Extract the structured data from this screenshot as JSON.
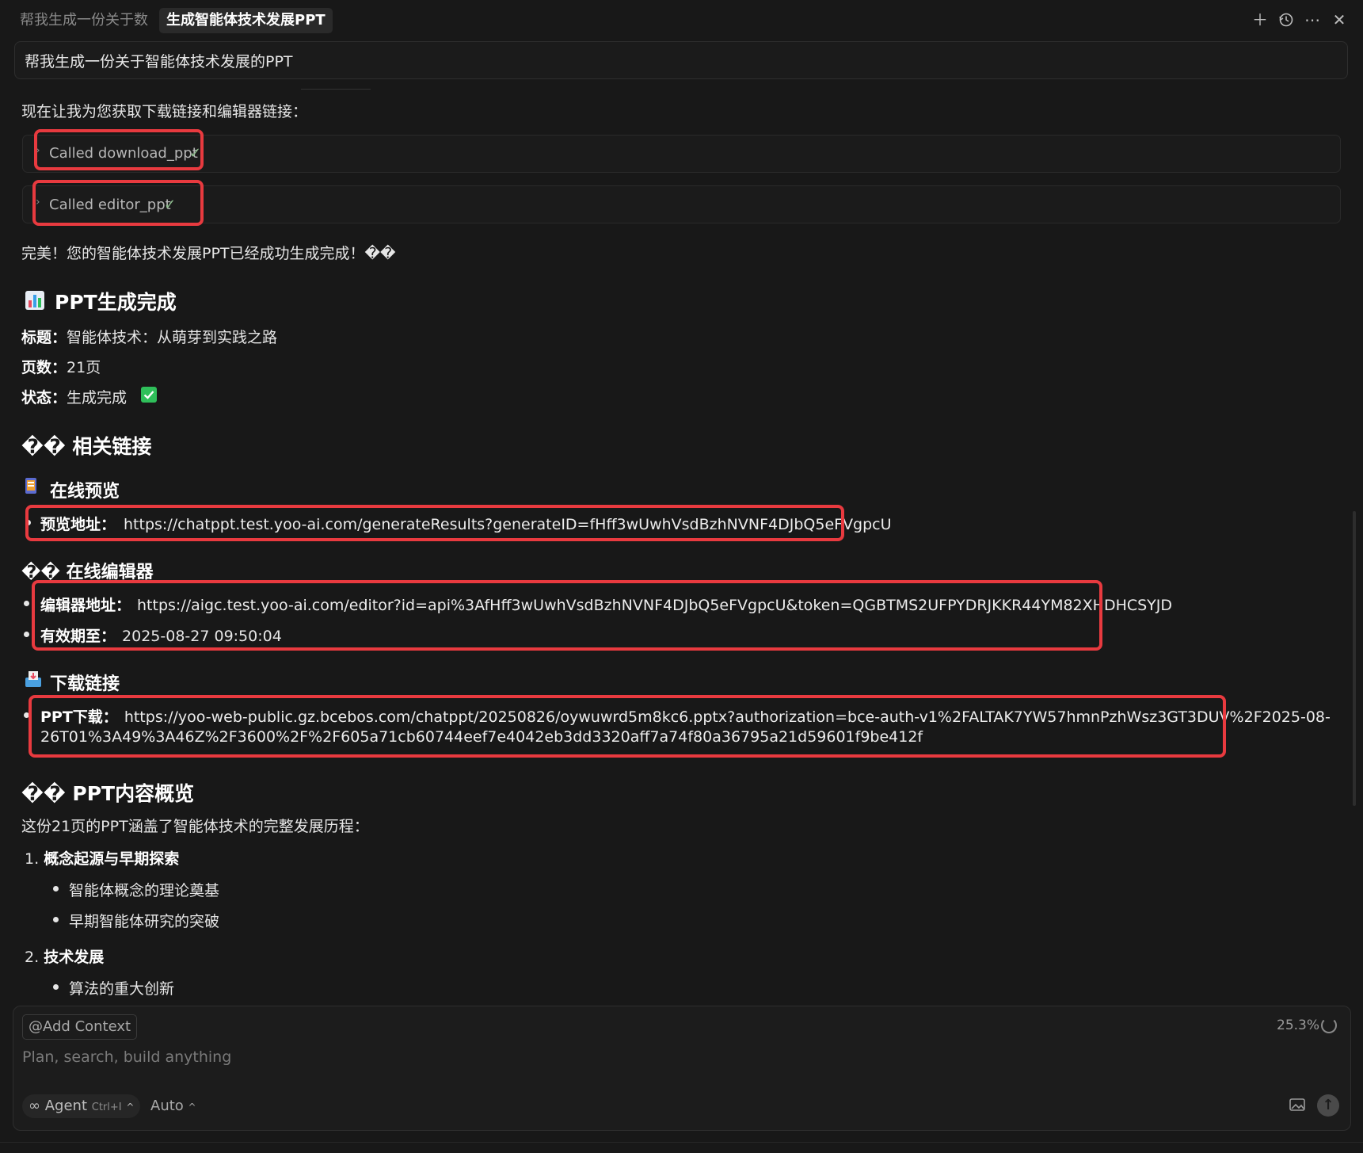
{
  "tabs": [
    {
      "label": "帮我生成一份关于数"
    },
    {
      "label": "生成智能体技术发展PPT"
    }
  ],
  "top_icons": [
    "plus-icon",
    "history-icon",
    "more-icon",
    "close-icon"
  ],
  "prompt": "帮我生成一份关于智能体技术发展的PPT",
  "intro": "现在让我为您获取下载链接和编辑器链接：",
  "tool_calls": [
    {
      "label": "Called download_ppt",
      "status": "✓"
    },
    {
      "label": "Called editor_ppt",
      "status": "✓"
    }
  ],
  "done_message": "完美！您的智能体技术发展PPT已经成功生成完成！��",
  "section_generated": {
    "heading": "PPT生成完成",
    "title_label": "标题：",
    "title_value": "智能体技术：从萌芽到实践之路",
    "pages_label": "页数：",
    "pages_value": "21页",
    "status_label": "状态：",
    "status_value": "生成完成"
  },
  "section_links": {
    "heading": "�� 相关链接",
    "preview": {
      "heading": "在线预览",
      "label": "预览地址：",
      "url": "https://chatppt.test.yoo-ai.com/generateResults?generateID=fHff3wUwhVsdBzhNVNF4DJbQ5eFVgpcU"
    },
    "editor": {
      "heading": "�� 在线编辑器",
      "label": "编辑器地址：",
      "url": "https://aigc.test.yoo-ai.com/editor?id=api%3AfHff3wUwhVsdBzhNVNF4DJbQ5eFVgpcU&token=QGBTMS2UFPYDRJKKR44YM82XHDHCSYJD",
      "expiry_label": "有效期至：",
      "expiry_value": "2025-08-27 09:50:04"
    },
    "download": {
      "heading": "下载链接",
      "label": "PPT下载：",
      "url_line1": "https://yoo-web-public.gz.bcebos.com/chatppt/20250826/oywuwrd5m8kc6.pptx?authorization=bce-auth-v1%2FALTAK7YW57hmnPzhWsz3GT3DUV%2F2025-08-",
      "url_line2": "26T01%3A49%3A46Z%2F3600%2F%2F605a71cb60744eef7e4042eb3dd3320aff7a74f80a36795a21d59601f9be412f"
    }
  },
  "section_overview": {
    "heading": "�� PPT内容概览",
    "intro": "这份21页的PPT涵盖了智能体技术的完整发展历程：",
    "items": [
      {
        "num": "1.",
        "title": "概念起源与早期探索",
        "bullets": [
          "智能体概念的理论奠基",
          "早期智能体研究的突破"
        ]
      },
      {
        "num": "2.",
        "title": "技术发展",
        "bullets": [
          "算法的重大创新"
        ]
      }
    ]
  },
  "input": {
    "add_context": "Add Context",
    "placeholder": "Plan, search, build anything",
    "usage": "25.3%",
    "agent_label": "Agent",
    "agent_shortcut": "Ctrl+I",
    "model_label": "Auto"
  },
  "colors": {
    "background": "#181818",
    "highlight_border": "#e83a3f",
    "check_green": "#2fbf5a"
  }
}
